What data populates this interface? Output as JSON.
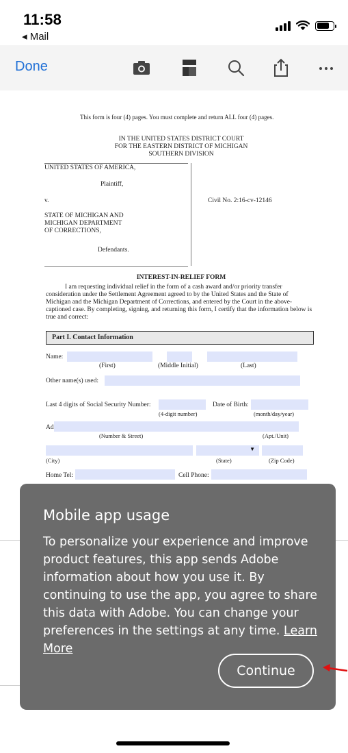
{
  "status_bar": {
    "time": "11:58",
    "back_app": "◂ Mail"
  },
  "toolbar": {
    "done_label": "Done",
    "icons": [
      "camera-icon",
      "bookmark-icon",
      "search-icon",
      "share-icon",
      "more-icon"
    ],
    "accent_color": "#1f6fd6"
  },
  "document": {
    "notice": "This form is four (4) pages.  You must complete and return ALL four (4) pages.",
    "court_line1": "IN THE UNITED STATES DISTRICT COURT",
    "court_line2": "FOR THE EASTERN DISTRICT OF MICHIGAN",
    "court_line3": "SOUTHERN DIVISION",
    "party1": "UNITED STATES OF AMERICA,",
    "plaintiff": "Plaintiff,",
    "versus": "v.",
    "civil_no": "Civil No. 2:16-cv-12146",
    "party2_line1": "STATE OF MICHIGAN AND",
    "party2_line2": "MICHIGAN DEPARTMENT",
    "party2_line3": "OF CORRECTIONS,",
    "defendants": "Defendants.",
    "form_title": "INTEREST-IN-RELIEF FORM",
    "intro_paragraph": "I am requesting individual relief in the form of a cash award and/or priority transfer consideration under the Settlement Agreement agreed to by the United States and the State of Michigan and the Michigan Department of Corrections, and entered by the Court in the above-captioned case.  By completing, signing, and returning this form, I certify that the information below is true and correct:",
    "part_heading": "Part I.  Contact Information",
    "name_label": "Name:",
    "first_label": "(First)",
    "middle_label": "(Middle Initial)",
    "last_label": "(Last)",
    "other_names_label": "Other name(s) used:",
    "ssn_label": "Last 4 digits of Social Security Number:",
    "ssn_sub": "(4-digit number)",
    "dob_label": "Date of Birth:",
    "dob_sub": "(month/day/year)",
    "address_label": "Address:",
    "street_sub": "(Number & Street)",
    "apt_sub": "(Apt./Unit)",
    "city_sub": "(City)",
    "state_sub": "(State)",
    "zip_sub": "(Zip Code)",
    "home_tel_label": "Home Tel:",
    "cell_label": "Cell Phone:"
  },
  "modal": {
    "title": "Mobile app usage",
    "body": "To personalize your experience and improve product features, this app sends Adobe information about how you use it. By continuing to use the app, you agree to share this data with Adobe. You can change your preferences in the settings at any time.",
    "learn_more": "Learn More",
    "continue_label": "Continue"
  }
}
